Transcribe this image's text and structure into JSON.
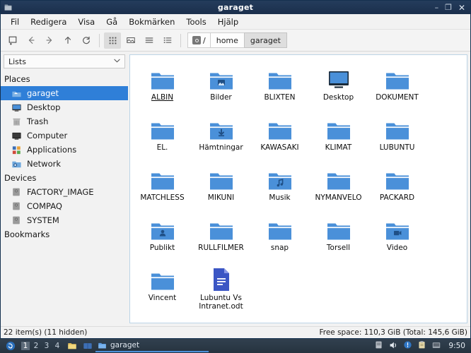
{
  "window": {
    "title": "garaget",
    "icon": "file-manager-icon",
    "buttons": {
      "minimize": "–",
      "maximize": "❐",
      "close": "✕"
    }
  },
  "menubar": {
    "items": [
      {
        "label": "Fil",
        "name": "menu-fil"
      },
      {
        "label": "Redigera",
        "name": "menu-redigera"
      },
      {
        "label": "Visa",
        "name": "menu-visa"
      },
      {
        "label": "Gå",
        "name": "menu-ga"
      },
      {
        "label": "Bokmärken",
        "name": "menu-bokmarken"
      },
      {
        "label": "Tools",
        "name": "menu-tools"
      },
      {
        "label": "Hjälp",
        "name": "menu-hjalp"
      }
    ]
  },
  "toolbar": {
    "buttons": [
      {
        "name": "new-tab-icon",
        "glyph": "new-tab"
      },
      {
        "name": "back-icon",
        "glyph": "←"
      },
      {
        "name": "forward-icon",
        "glyph": "→"
      },
      {
        "name": "up-icon",
        "glyph": "↑"
      },
      {
        "name": "reload-icon",
        "glyph": "⟳"
      }
    ],
    "view_modes": [
      {
        "name": "icon-view-icon",
        "glyph": "grid",
        "active": true
      },
      {
        "name": "thumbnail-view-icon",
        "glyph": "image",
        "active": false
      },
      {
        "name": "compact-view-icon",
        "glyph": "lines",
        "active": false
      },
      {
        "name": "detailed-list-view-icon",
        "glyph": "list",
        "active": false
      }
    ],
    "breadcrumbs": [
      {
        "label": "/",
        "name": "breadcrumb-root",
        "icon": "drive-icon",
        "pressed": false
      },
      {
        "label": "home",
        "name": "breadcrumb-home",
        "pressed": false
      },
      {
        "label": "garaget",
        "name": "breadcrumb-garaget",
        "pressed": true
      }
    ]
  },
  "sidebar": {
    "combo": {
      "value": "Lists",
      "chevron": "∨"
    },
    "groups": [
      {
        "label": "Places",
        "name": "sidebar-group-places",
        "items": [
          {
            "label": "garaget",
            "icon": "home-folder-icon",
            "selected": true
          },
          {
            "label": "Desktop",
            "icon": "desktop-icon",
            "selected": false
          },
          {
            "label": "Trash",
            "icon": "trash-icon",
            "selected": false
          },
          {
            "label": "Computer",
            "icon": "computer-icon",
            "selected": false
          },
          {
            "label": "Applications",
            "icon": "applications-icon",
            "selected": false
          },
          {
            "label": "Network",
            "icon": "network-icon",
            "selected": false
          }
        ]
      },
      {
        "label": "Devices",
        "name": "sidebar-group-devices",
        "items": [
          {
            "label": "FACTORY_IMAGE",
            "icon": "drive-icon",
            "selected": false
          },
          {
            "label": "COMPAQ",
            "icon": "drive-icon",
            "selected": false
          },
          {
            "label": "SYSTEM",
            "icon": "drive-icon",
            "selected": false
          }
        ]
      },
      {
        "label": "Bookmarks",
        "name": "sidebar-group-bookmarks",
        "items": []
      }
    ]
  },
  "files": [
    {
      "label": "ALBIN",
      "type": "folder",
      "badge": "",
      "hovered": true
    },
    {
      "label": "Bilder",
      "type": "folder",
      "badge": "image",
      "hovered": false
    },
    {
      "label": "BLIXTEN",
      "type": "folder",
      "badge": "",
      "hovered": false
    },
    {
      "label": "Desktop",
      "type": "monitor",
      "badge": "",
      "hovered": false
    },
    {
      "label": "DOKUMENT",
      "type": "folder",
      "badge": "",
      "hovered": false
    },
    {
      "label": "EL.",
      "type": "folder",
      "badge": "",
      "hovered": false
    },
    {
      "label": "Hämtningar",
      "type": "folder",
      "badge": "download",
      "hovered": false
    },
    {
      "label": "KAWASAKI",
      "type": "folder",
      "badge": "",
      "hovered": false
    },
    {
      "label": "KLIMAT",
      "type": "folder",
      "badge": "",
      "hovered": false
    },
    {
      "label": "LUBUNTU",
      "type": "folder",
      "badge": "",
      "hovered": false
    },
    {
      "label": "MATCHLESS",
      "type": "folder",
      "badge": "",
      "hovered": false
    },
    {
      "label": "MIKUNI",
      "type": "folder",
      "badge": "",
      "hovered": false
    },
    {
      "label": "Musik",
      "type": "folder",
      "badge": "music",
      "hovered": false
    },
    {
      "label": "NYMANVELO",
      "type": "folder",
      "badge": "",
      "hovered": false
    },
    {
      "label": "PACKARD",
      "type": "folder",
      "badge": "",
      "hovered": false
    },
    {
      "label": "Publikt",
      "type": "folder",
      "badge": "person",
      "hovered": false
    },
    {
      "label": "RULLFILMER",
      "type": "folder",
      "badge": "",
      "hovered": false
    },
    {
      "label": "snap",
      "type": "folder",
      "badge": "",
      "hovered": false
    },
    {
      "label": "Torsell",
      "type": "folder",
      "badge": "",
      "hovered": false
    },
    {
      "label": "Video",
      "type": "folder",
      "badge": "video",
      "hovered": false
    },
    {
      "label": "Vincent",
      "type": "folder",
      "badge": "",
      "hovered": false
    },
    {
      "label": "Lubuntu Vs Intranet.odt",
      "type": "document",
      "badge": "",
      "hovered": false
    }
  ],
  "statusbar": {
    "left": "22 item(s) (11 hidden)",
    "right": "Free space: 110,3 GiB (Total: 145,6 GiB)"
  },
  "taskbar": {
    "menu_icon": "lubuntu-start-icon",
    "desktops": [
      {
        "label": "1",
        "active": true
      },
      {
        "label": "2",
        "active": false
      },
      {
        "label": "3",
        "active": false
      },
      {
        "label": "4",
        "active": false
      }
    ],
    "launchers": [
      {
        "name": "file-manager-launcher-icon"
      },
      {
        "name": "web-browser-launcher-icon"
      }
    ],
    "tasks": [
      {
        "label": "garaget",
        "icon": "folder-icon",
        "active": true
      }
    ],
    "tray": [
      {
        "name": "keyboard-tray-icon"
      },
      {
        "name": "volume-tray-icon"
      },
      {
        "name": "update-tray-icon"
      },
      {
        "name": "clipboard-tray-icon"
      },
      {
        "name": "network-tray-icon"
      }
    ],
    "clock": "9:50"
  },
  "colors": {
    "titlebar": "#1d3557",
    "selection": "#2f7fd8",
    "folder": "#4a90d9",
    "taskbar": "#2b3a4a",
    "accent_underline": "#4a90d9"
  }
}
